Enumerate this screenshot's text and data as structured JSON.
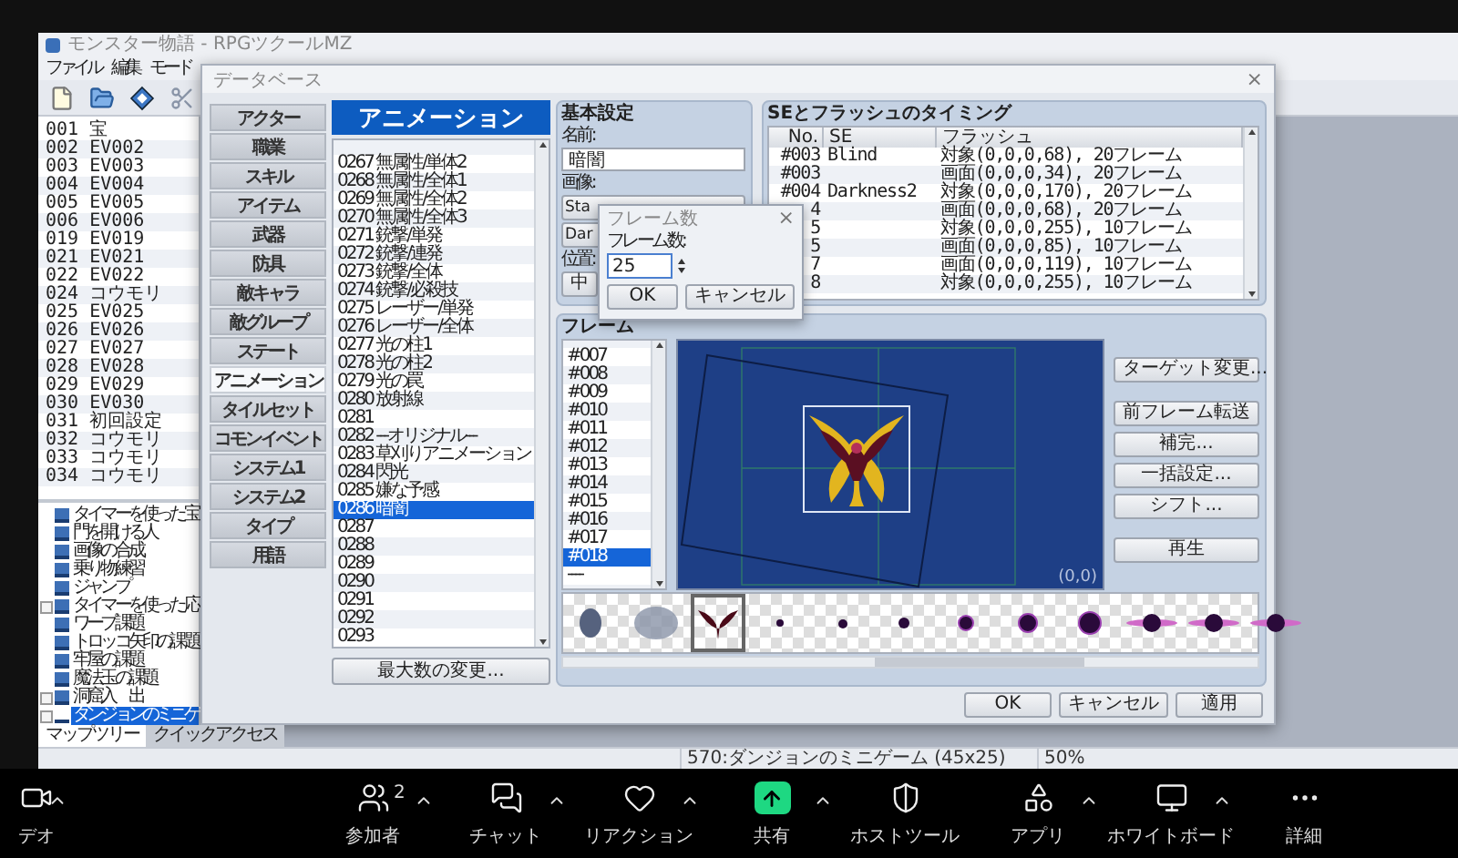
{
  "app_window": {
    "title": "モンスター物語 - RPGツクールMZ",
    "menu": [
      "ファイル",
      "編集",
      "モード"
    ],
    "events": [
      "001 宝",
      "002 EV002",
      "003 EV003",
      "004 EV004",
      "005 EV005",
      "006 EV006",
      "019 EV019",
      "021 EV021",
      "022 EV022",
      "024 コウモリ",
      "025 EV025",
      "026 EV026",
      "027 EV027",
      "028 EV028",
      "029 EV029",
      "030 EV030",
      "031 初回設定",
      "032 コウモリ",
      "033 コウモリ",
      "034 コウモリ"
    ],
    "map_tree": [
      {
        "label": "タイマーを使った宝",
        "expandable": false,
        "selected": false
      },
      {
        "label": "門を開ける人",
        "expandable": false,
        "selected": false
      },
      {
        "label": "画像の合成",
        "expandable": false,
        "selected": false
      },
      {
        "label": "乗り物練習",
        "expandable": false,
        "selected": false
      },
      {
        "label": "ジャンプ",
        "expandable": false,
        "selected": false
      },
      {
        "label": "タイマーを使った応",
        "expandable": true,
        "selected": false
      },
      {
        "label": "ワープ課題",
        "expandable": false,
        "selected": false
      },
      {
        "label": "トロッコ矢印の課題",
        "expandable": false,
        "selected": false
      },
      {
        "label": "牢屋の課題",
        "expandable": false,
        "selected": false
      },
      {
        "label": "魔法玉の課題",
        "expandable": false,
        "selected": false
      },
      {
        "label": "洞窟入　出",
        "expandable": true,
        "selected": false
      },
      {
        "label": "ダンジョンのミニゲ",
        "expandable": true,
        "selected": true
      }
    ],
    "tabs": [
      {
        "label": "マップツリー",
        "selected": true
      },
      {
        "label": "クイックアクセス",
        "selected": false
      }
    ],
    "status": {
      "map": "570:ダンジョンのミニゲーム (45x25)",
      "zoom": "50%"
    }
  },
  "database": {
    "title": "データベース",
    "close": "×",
    "categories": [
      {
        "label": "アクター",
        "selected": false
      },
      {
        "label": "職業",
        "selected": false
      },
      {
        "label": "スキル",
        "selected": false
      },
      {
        "label": "アイテム",
        "selected": false
      },
      {
        "label": "武器",
        "selected": false
      },
      {
        "label": "防具",
        "selected": false
      },
      {
        "label": "敵キャラ",
        "selected": false
      },
      {
        "label": "敵グループ",
        "selected": false
      },
      {
        "label": "ステート",
        "selected": false
      },
      {
        "label": "アニメーション",
        "selected": true
      },
      {
        "label": "タイルセット",
        "selected": false
      },
      {
        "label": "コモンイベント",
        "selected": false
      },
      {
        "label": "システム1",
        "selected": false
      },
      {
        "label": "システム2",
        "selected": false
      },
      {
        "label": "タイプ",
        "selected": false
      },
      {
        "label": "用語",
        "selected": false
      }
    ],
    "list_title": "アニメーション",
    "animations": [
      {
        "label": "0267 無属性/単体2",
        "selected": false
      },
      {
        "label": "0268 無属性/全体1",
        "selected": false
      },
      {
        "label": "0269 無属性/全体2",
        "selected": false
      },
      {
        "label": "0270 無属性/全体3",
        "selected": false
      },
      {
        "label": "0271 銃撃/単発",
        "selected": false
      },
      {
        "label": "0272 銃撃/連発",
        "selected": false
      },
      {
        "label": "0273 銃撃/全体",
        "selected": false
      },
      {
        "label": "0274 銃撃/必殺技",
        "selected": false
      },
      {
        "label": "0275 レーザー/単発",
        "selected": false
      },
      {
        "label": "0276 レーザー/全体",
        "selected": false
      },
      {
        "label": "0277 光の柱1",
        "selected": false
      },
      {
        "label": "0278 光の柱2",
        "selected": false
      },
      {
        "label": "0279 光の罠",
        "selected": false
      },
      {
        "label": "0280 放射線",
        "selected": false
      },
      {
        "label": "0281",
        "selected": false
      },
      {
        "label": "0282 ---オリジナル---",
        "selected": false
      },
      {
        "label": "0283 草刈りアニメーション",
        "selected": false
      },
      {
        "label": "0284 閃光",
        "selected": false
      },
      {
        "label": "0285 嫌な予感",
        "selected": false
      },
      {
        "label": "0286 暗闇",
        "selected": true
      },
      {
        "label": "0287",
        "selected": false
      },
      {
        "label": "0288",
        "selected": false
      },
      {
        "label": "0289",
        "selected": false
      },
      {
        "label": "0290",
        "selected": false
      },
      {
        "label": "0291",
        "selected": false
      },
      {
        "label": "0292",
        "selected": false
      },
      {
        "label": "0293",
        "selected": false
      }
    ],
    "max_button": "最大数の変更...",
    "basic": {
      "title": "基本設定",
      "name_label": "名前:",
      "name": "暗闇",
      "image_label": "画像:",
      "image_buttons": [
        "Sta",
        "Dar"
      ],
      "position_label": "位置:",
      "position": "中"
    },
    "timing": {
      "title": "SEとフラッシュのタイミング",
      "columns": [
        "No.",
        "SE",
        "フラッシュ"
      ],
      "rows": [
        [
          "#003",
          "Blind",
          "対象(0,0,0,68), 20フレーム"
        ],
        [
          "#003",
          "",
          "画面(0,0,0,34), 20フレーム"
        ],
        [
          "#004",
          "Darkness2",
          "対象(0,0,0,170), 20フレーム"
        ],
        [
          "4",
          "",
          "画面(0,0,0,68), 20フレーム"
        ],
        [
          "5",
          "",
          "対象(0,0,0,255), 10フレーム"
        ],
        [
          "5",
          "",
          "画面(0,0,0,85), 10フレーム"
        ],
        [
          "7",
          "",
          "画面(0,0,0,119), 10フレーム"
        ],
        [
          "8",
          "",
          "対象(0,0,0,255), 10フレーム"
        ]
      ]
    },
    "frames": {
      "title": "フレーム",
      "items": [
        {
          "label": "#007",
          "selected": false
        },
        {
          "label": "#008",
          "selected": false
        },
        {
          "label": "#009",
          "selected": false
        },
        {
          "label": "#010",
          "selected": false
        },
        {
          "label": "#011",
          "selected": false
        },
        {
          "label": "#012",
          "selected": false
        },
        {
          "label": "#013",
          "selected": false
        },
        {
          "label": "#014",
          "selected": false
        },
        {
          "label": "#015",
          "selected": false
        },
        {
          "label": "#016",
          "selected": false
        },
        {
          "label": "#017",
          "selected": false
        },
        {
          "label": "#018",
          "selected": true
        },
        {
          "label": "----",
          "selected": false
        }
      ],
      "coordinates": "(0,0)",
      "buttons": [
        "ターゲット変更...",
        "前フレーム転送",
        "補完...",
        "一括設定...",
        "シフト...",
        "再生"
      ]
    },
    "buttons": [
      "OK",
      "キャンセル",
      "適用"
    ]
  },
  "frame_count_dialog": {
    "title": "フレーム数",
    "close": "×",
    "label": "フレーム数:",
    "value": "25",
    "buttons": [
      "OK",
      "キャンセル"
    ]
  },
  "meeting_toolbar": [
    {
      "label": "デオ",
      "caret": true
    },
    {
      "label": "参加者",
      "count": "2",
      "caret": true
    },
    {
      "label": "チャット",
      "caret": true
    },
    {
      "label": "リアクション",
      "caret": true
    },
    {
      "label": "共有",
      "caret": true
    },
    {
      "label": "ホストツール",
      "caret": false
    },
    {
      "label": "アプリ",
      "caret": true
    },
    {
      "label": "ホワイトボード",
      "caret": true
    },
    {
      "label": "詳細",
      "caret": false
    }
  ]
}
